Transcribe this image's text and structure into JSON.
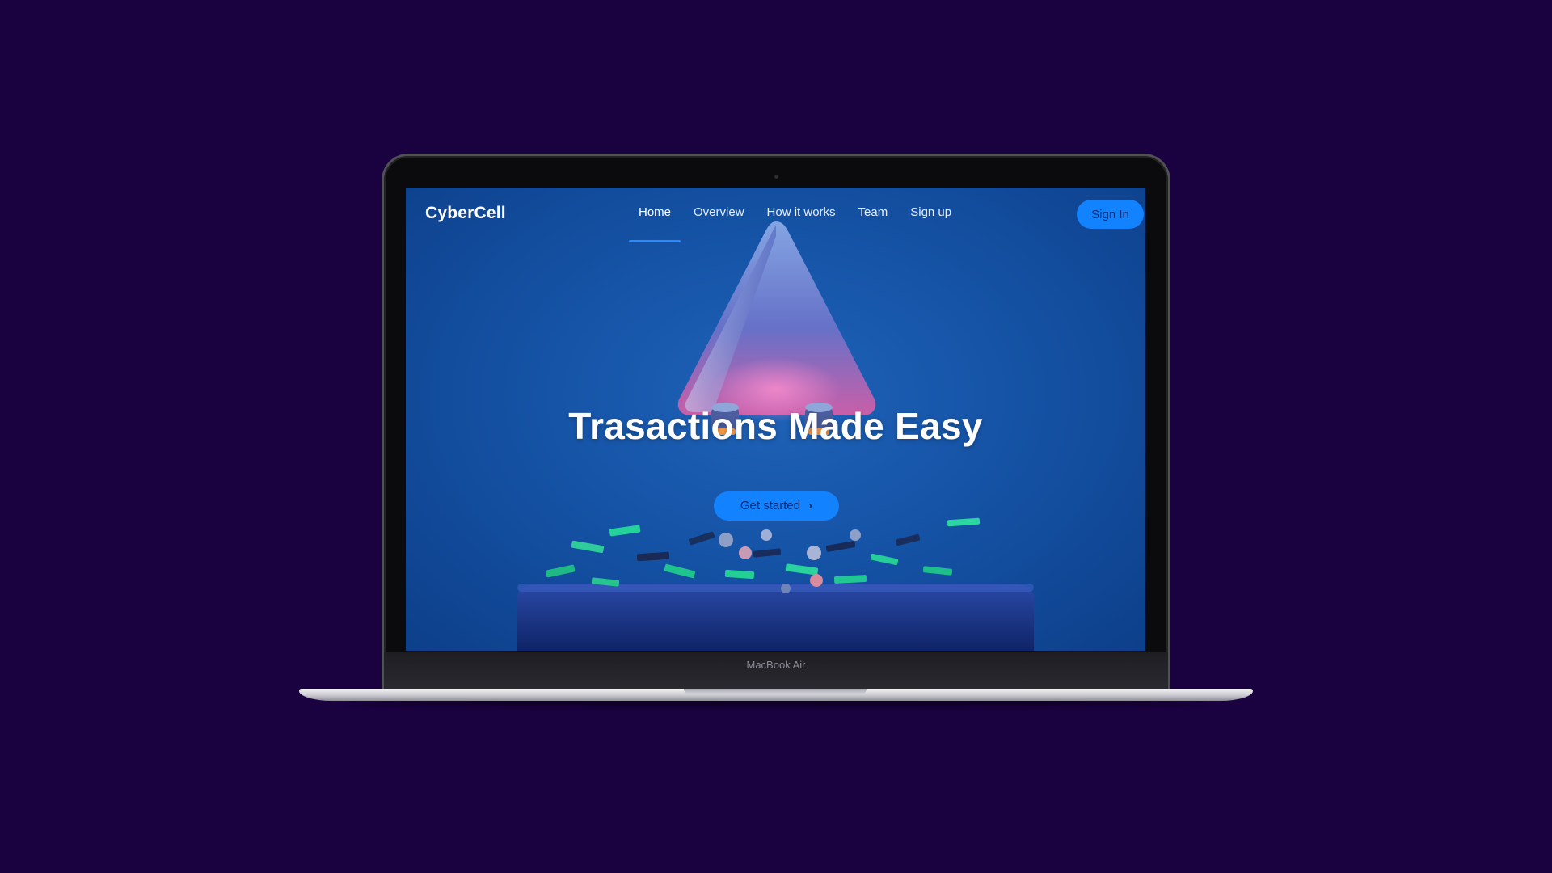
{
  "device": {
    "model_label": "MacBook Air"
  },
  "site": {
    "brand": "CyberCell",
    "nav": [
      {
        "label": "Home",
        "active": true
      },
      {
        "label": "Overview",
        "active": false
      },
      {
        "label": "How it works",
        "active": false
      },
      {
        "label": "Team",
        "active": false
      },
      {
        "label": "Sign up",
        "active": false
      }
    ],
    "sign_in_label": "Sign In"
  },
  "hero": {
    "title": "Trasactions Made Easy",
    "cta_label": "Get started",
    "cta_icon": "chevron-right-icon"
  },
  "colors": {
    "background": "#1a0140",
    "screen_blue": "#1553a6",
    "accent": "#1282ff",
    "active_underline": "#2a8bff"
  }
}
